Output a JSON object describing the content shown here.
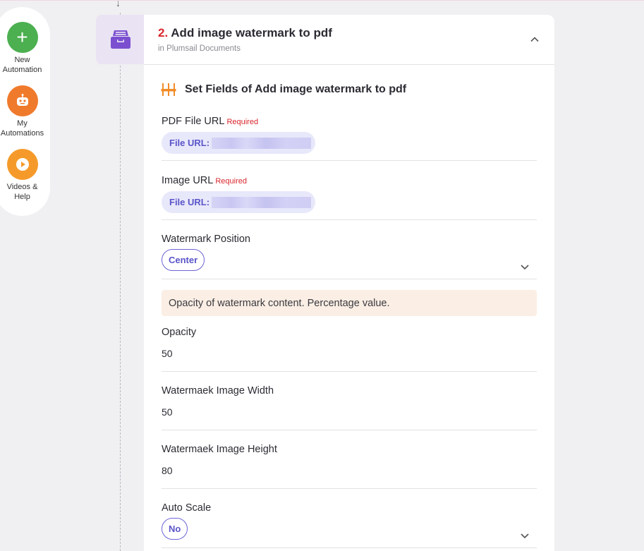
{
  "nav": {
    "new_label": "New\nAutomation",
    "my_label": "My\nAutomations",
    "videos_label": "Videos &\nHelp"
  },
  "step": {
    "number": "2.",
    "title": "Add image watermark to pdf",
    "subtitle": "in Plumsail Documents"
  },
  "section": {
    "title": "Set Fields of Add image watermark to pdf"
  },
  "fields": {
    "pdf_url": {
      "label": "PDF File URL",
      "required": "Required",
      "chip": "File URL:"
    },
    "image_url": {
      "label": "Image URL",
      "required": "Required",
      "chip": "File URL:"
    },
    "position": {
      "label": "Watermark Position",
      "value": "Center"
    },
    "hint": "Opacity of watermark content. Percentage value.",
    "opacity": {
      "label": "Opacity",
      "value": "50"
    },
    "width": {
      "label": "Watermaek Image Width",
      "value": "50"
    },
    "height": {
      "label": "Watermaek Image Height",
      "value": "80"
    },
    "auto_scale": {
      "label": "Auto Scale",
      "value": "No"
    }
  },
  "colors": {
    "accent": "#5a55c9",
    "required": "#d9262b",
    "new_automation": "#4caf50",
    "my_automations": "#f07a2c",
    "videos": "#f59a2a",
    "hint_bg": "#fbeee4"
  },
  "icons": {
    "new": "plus-icon",
    "my": "robot-icon",
    "videos": "play-icon",
    "app": "archive-drawer-icon",
    "section": "sliders-icon",
    "collapse": "chevron-up-icon",
    "dropdown": "chevron-down-icon"
  }
}
